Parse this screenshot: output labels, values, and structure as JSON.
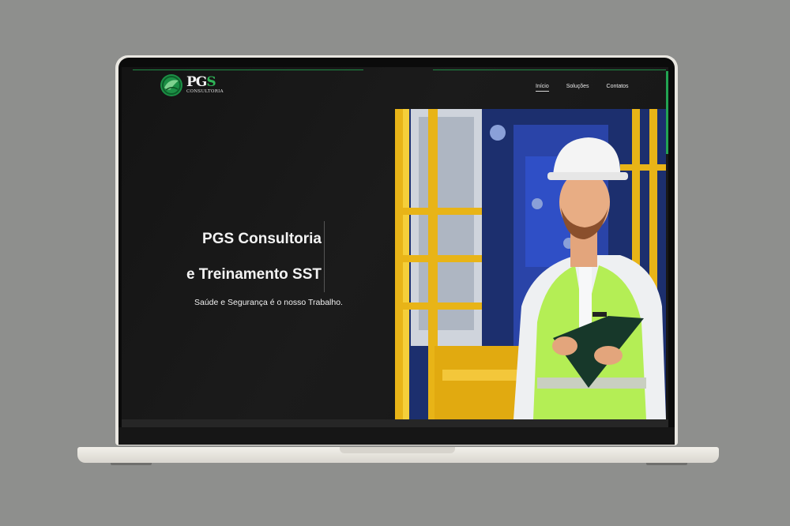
{
  "brand": {
    "name_main": "PG",
    "name_accent": "S",
    "tagline": "CONSULTORIA"
  },
  "nav": {
    "items": [
      "Início",
      "Soluções",
      "Contatos"
    ]
  },
  "hero": {
    "title_line1": "PGS Consultoria",
    "title_line2": "e Treinamento SST",
    "subtitle": "Saúde e Segurança é o nosso Trabalho."
  },
  "colors": {
    "background": "#141414",
    "accent": "#22a352",
    "text": "#f3f3f3"
  },
  "icons": {
    "logo": "circular-leaf-emblem-icon"
  }
}
